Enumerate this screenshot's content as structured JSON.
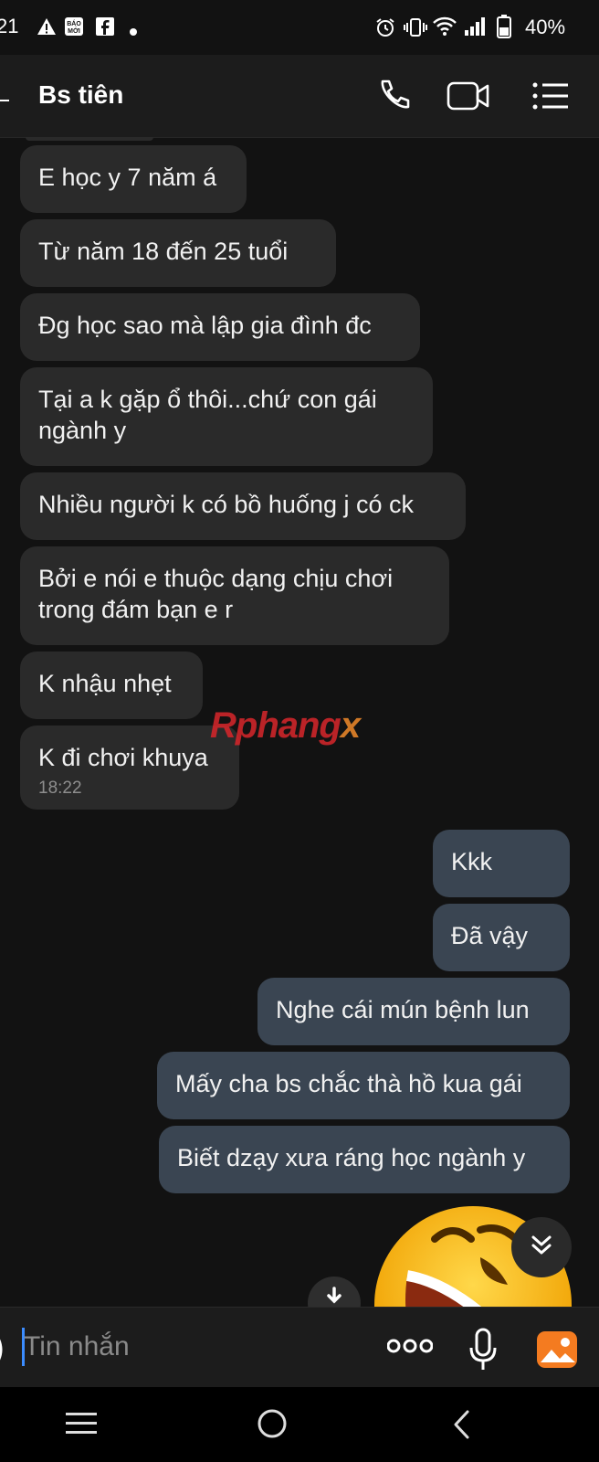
{
  "status_bar": {
    "time": "21",
    "battery": "40%",
    "left_icons": [
      "warning-icon",
      "baomoi-icon",
      "facebook-icon",
      "dot-icon"
    ],
    "right_icons": [
      "alarm-icon",
      "vibrate-icon",
      "wifi-icon",
      "signal-icon",
      "battery-icon"
    ]
  },
  "header": {
    "title": "Bs tiên",
    "actions": [
      "phone-icon",
      "video-icon",
      "menu-icon"
    ]
  },
  "messages": [
    {
      "dir": "in",
      "text": "E học y 7 năm á"
    },
    {
      "dir": "in",
      "text": "Từ năm 18 đến 25 tuổi"
    },
    {
      "dir": "in",
      "text": "Đg học sao mà lập gia đình đc"
    },
    {
      "dir": "in",
      "text": "Tại a k gặp ổ thôi...chứ con gái ngành y"
    },
    {
      "dir": "in",
      "text": "Nhiều người k có bồ huống j có ck"
    },
    {
      "dir": "in",
      "text": "Bởi e nói e thuộc dạng chịu chơi trong đám bạn e r"
    },
    {
      "dir": "in",
      "text": "K nhậu nhẹt"
    },
    {
      "dir": "in",
      "text": "K đi chơi khuya",
      "time": "18:22"
    },
    {
      "dir": "out",
      "text": "Kkk"
    },
    {
      "dir": "out",
      "text": "Đã vậy"
    },
    {
      "dir": "out",
      "text": "Nghe cái mún bệnh lun"
    },
    {
      "dir": "out",
      "text": "Mấy cha bs chắc thà hồ kua gái"
    },
    {
      "dir": "out",
      "text": "Biết dzạy xưa ráng học ngành y"
    }
  ],
  "watermark": {
    "text_main": "Rphang",
    "text_accent": "x"
  },
  "input": {
    "placeholder": "Tin nhắn"
  },
  "colors": {
    "incoming": "#2a2a2a",
    "outgoing": "#3a4552",
    "accent": "#3b8cff",
    "emoji": "#f4b400"
  }
}
